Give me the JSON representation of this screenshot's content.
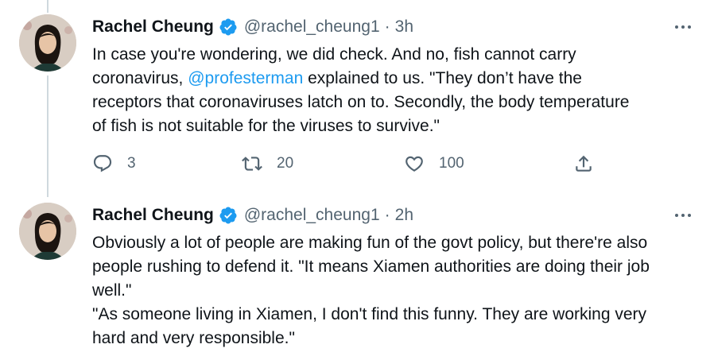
{
  "tweets": [
    {
      "author": {
        "name": "Rachel Cheung",
        "handle": "@rachel_cheung1",
        "verified": true
      },
      "time": "3h",
      "text_lines": [
        "In case you're wondering, we did check. And no, fish cannot carry",
        {
          "before": "coronavirus, ",
          "mention": "@profesterman",
          "after": " explained to us. \"They don’t have the"
        },
        "receptors that coronaviruses latch on to. Secondly, the body temperature",
        "of fish is not suitable for the viruses to survive.\""
      ],
      "stats": {
        "replies": "3",
        "retweets": "20",
        "likes": "100"
      }
    },
    {
      "author": {
        "name": "Rachel Cheung",
        "handle": "@rachel_cheung1",
        "verified": true
      },
      "time": "2h",
      "text_lines": [
        "Obviously a lot of people are making fun of the govt policy, but there're also",
        "people rushing to defend it. \"It means Xiamen authorities are doing their job",
        "well.\"",
        "\"As someone living in Xiamen, I don't find this funny. They are working very",
        "hard and very responsible.\""
      ]
    }
  ],
  "ui": {
    "separator": "·"
  },
  "colors": {
    "accent": "#1d9bf0",
    "text": "#0f1419",
    "secondary": "#536471",
    "thread_line": "#cfd9de"
  },
  "icons": {
    "verified": "verified-badge-icon",
    "more": "more-horizontal-icon",
    "reply": "reply-icon",
    "retweet": "retweet-icon",
    "like": "heart-icon",
    "share": "share-icon"
  }
}
